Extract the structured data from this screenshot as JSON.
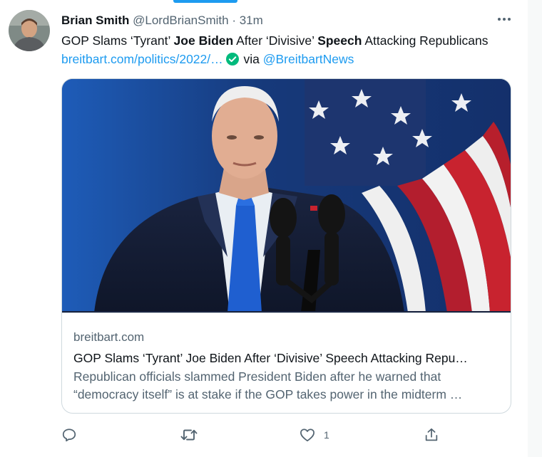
{
  "author": {
    "name": "Brian Smith",
    "handle": "@LordBrianSmith",
    "separator": "·",
    "time": "31m"
  },
  "tweet": {
    "seg1": "GOP Slams ‘Tyrant’ ",
    "bold1": "Joe Biden",
    "seg2": " After ‘Divisive’ ",
    "bold2": "Speech",
    "seg3": " Attacking Republicans ",
    "link": "breitbart.com/politics/2022/…",
    "via": " via ",
    "mention": "@BreitbartNews"
  },
  "card": {
    "domain": "breitbart.com",
    "title": "GOP Slams ‘Tyrant’ Joe Biden After ‘Divisive’ Speech Attacking Repu…",
    "description": "Republican officials slammed President Biden after he warned that “democracy itself” is at stake if the GOP takes power in the midterm …"
  },
  "actions": {
    "reply_icon": "reply-icon",
    "retweet_icon": "retweet-icon",
    "like_icon": "heart-icon",
    "like_count": "1",
    "share_icon": "share-icon"
  },
  "colors": {
    "accent": "#1d9bf0",
    "verified": "#00ba7c",
    "muted": "#536471",
    "text": "#0f1419",
    "border": "#cfd9de"
  }
}
